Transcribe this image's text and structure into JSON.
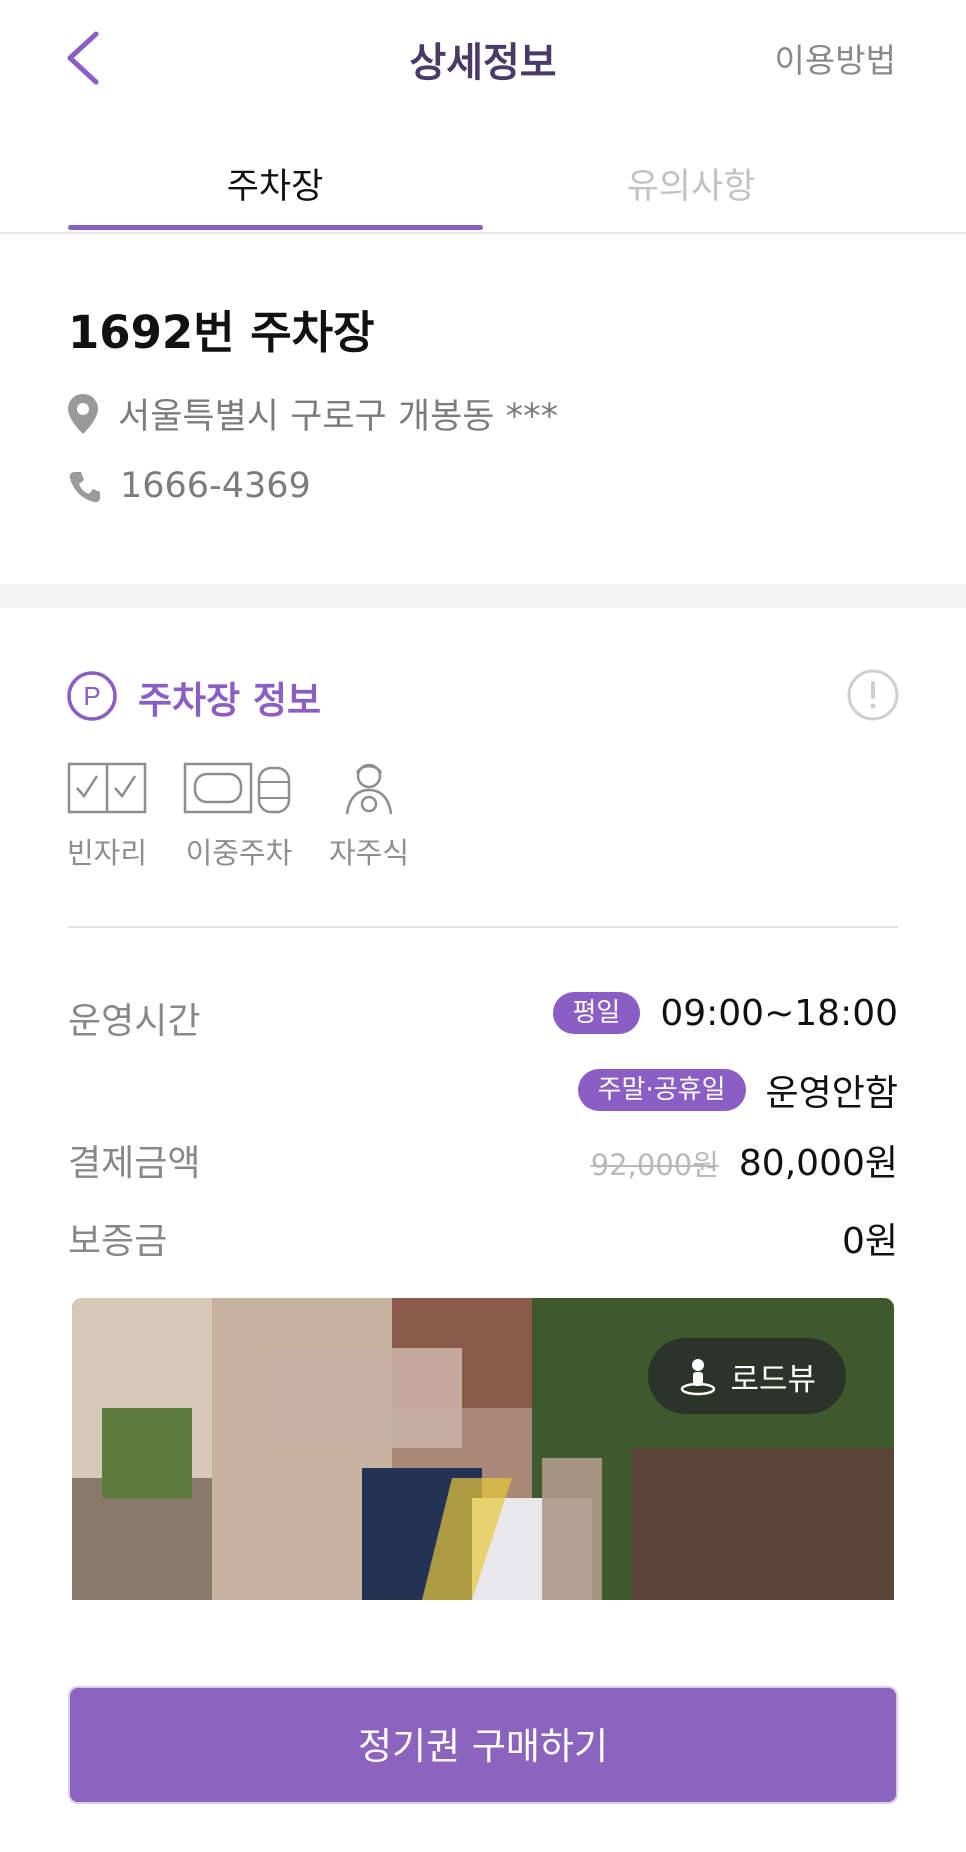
{
  "header": {
    "title": "상세정보",
    "help_link": "이용방법"
  },
  "tabs": [
    {
      "label": "주차장",
      "active": true
    },
    {
      "label": "유의사항",
      "active": false
    }
  ],
  "lot": {
    "name": "1692번 주차장",
    "address": "서울특별시 구로구 개봉동 ***",
    "phone": "1666-4369"
  },
  "section": {
    "title": "주차장 정보",
    "features": [
      {
        "label": "빈자리",
        "icon": "empty-slot-icon"
      },
      {
        "label": "이중주차",
        "icon": "double-parking-icon"
      },
      {
        "label": "자주식",
        "icon": "self-parking-icon"
      }
    ]
  },
  "details": {
    "hours_label": "운영시간",
    "weekday_badge": "평일",
    "weekday_hours": "09:00~18:00",
    "weekend_badge": "주말·공휴일",
    "weekend_hours": "운영안함",
    "price_label": "결제금액",
    "original_price": "92,000원",
    "price": "80,000원",
    "deposit_label": "보증금",
    "deposit": "0원"
  },
  "photo": {
    "roadview_label": "로드뷰"
  },
  "cta": {
    "label": "정기권 구매하기"
  },
  "colors": {
    "accent": "#8a5ec4",
    "title": "#4a3a66",
    "muted": "#888888"
  }
}
